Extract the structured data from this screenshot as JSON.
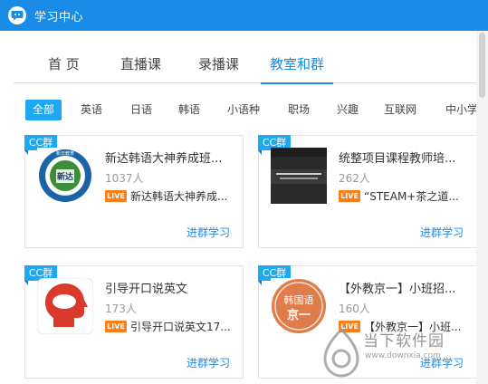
{
  "window": {
    "title": "学习中心",
    "logo_icon": "chat-bubble-icon"
  },
  "tabs": [
    {
      "label": "首 页",
      "active": false
    },
    {
      "label": "直播课",
      "active": false
    },
    {
      "label": "录播课",
      "active": false
    },
    {
      "label": "教室和群",
      "active": true
    }
  ],
  "filters": [
    "全部",
    "英语",
    "日语",
    "韩语",
    "小语种",
    "职场",
    "兴趣",
    "互联网",
    "中小学"
  ],
  "filters_active": "全部",
  "cards": [
    {
      "badge": "CC群",
      "name": "新达韩语大神养成班...",
      "count": "1037人",
      "live": "LIVE",
      "live_title": "新达韩语大神养成...",
      "join": "进群学习",
      "thumb": "school-emblem-thumbnail"
    },
    {
      "badge": "CC群",
      "name": "统整项目课程教师培...",
      "count": "262人",
      "live": "LIVE",
      "live_title": "“STEAM+茶之道...",
      "join": "进群学习",
      "thumb": "dark-banner-thumbnail"
    },
    {
      "badge": "CC群",
      "name": "引导开口说英文",
      "count": "173人",
      "live": "LIVE",
      "live_title": "引导开口说英文17...",
      "join": "进群学习",
      "thumb": "speaking-head-thumbnail"
    },
    {
      "badge": "CC群",
      "name": "【外教京一】小班招...",
      "count": "160人",
      "live": "LIVE",
      "live_title": "【外教京一】小班...",
      "join": "进群学习",
      "thumb": "korean-logo-thumbnail"
    }
  ],
  "thumb_text": {
    "school_emblem": {
      "top": "新日教育",
      "center": "新达"
    },
    "korean_logo": {
      "top": "韩国语",
      "bottom": "京一"
    }
  },
  "watermark": {
    "text": "当下软件园",
    "url": "www.downxia.com"
  },
  "colors": {
    "accent": "#1a8be6",
    "badge": "#1fa8f2",
    "live": "#ff7e16"
  }
}
